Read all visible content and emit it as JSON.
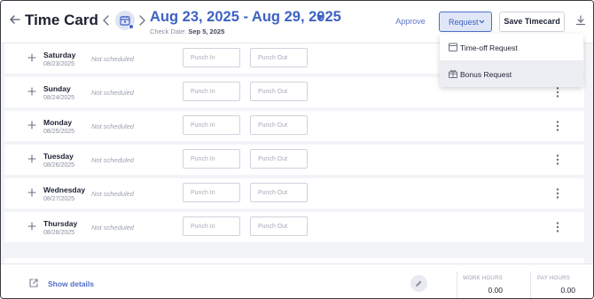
{
  "header": {
    "title": "Time Card",
    "date_range": "Aug 23, 2025 - Aug 29, 2025",
    "check_date_label": "Check Date:",
    "check_date_value": "Sep 5, 2025",
    "approve_label": "Approve",
    "request_label": "Request",
    "save_label": "Save Timecard"
  },
  "request_menu": {
    "items": [
      {
        "label": "Time-off Request",
        "icon": "calendar-icon"
      },
      {
        "label": "Bonus Request",
        "icon": "gift-icon"
      }
    ]
  },
  "rows": [
    {
      "day": "Saturday",
      "date": "08/23/2025",
      "status": "Not scheduled",
      "punch_in_placeholder": "Punch In",
      "punch_out_placeholder": "Punch Out"
    },
    {
      "day": "Sunday",
      "date": "08/24/2025",
      "status": "Not scheduled",
      "punch_in_placeholder": "Punch In",
      "punch_out_placeholder": "Punch Out"
    },
    {
      "day": "Monday",
      "date": "08/25/2025",
      "status": "Not scheduled",
      "punch_in_placeholder": "Punch In",
      "punch_out_placeholder": "Punch Out"
    },
    {
      "day": "Tuesday",
      "date": "08/26/2025",
      "status": "Not scheduled",
      "punch_in_placeholder": "Punch In",
      "punch_out_placeholder": "Punch Out"
    },
    {
      "day": "Wednesday",
      "date": "08/27/2025",
      "status": "Not scheduled",
      "punch_in_placeholder": "Punch In",
      "punch_out_placeholder": "Punch Out"
    },
    {
      "day": "Thursday",
      "date": "08/28/2025",
      "status": "Not scheduled",
      "punch_in_placeholder": "Punch In",
      "punch_out_placeholder": "Punch Out"
    }
  ],
  "footer": {
    "show_details_label": "Show details",
    "work_hours_label": "WORK HOURS",
    "work_hours_value": "0.00",
    "pay_hours_label": "PAY HOURS",
    "pay_hours_value": "0.00"
  },
  "colors": {
    "accent": "#3d62c4",
    "request_bg": "#dfe6f7",
    "page_bg": "#f3f4f7"
  }
}
